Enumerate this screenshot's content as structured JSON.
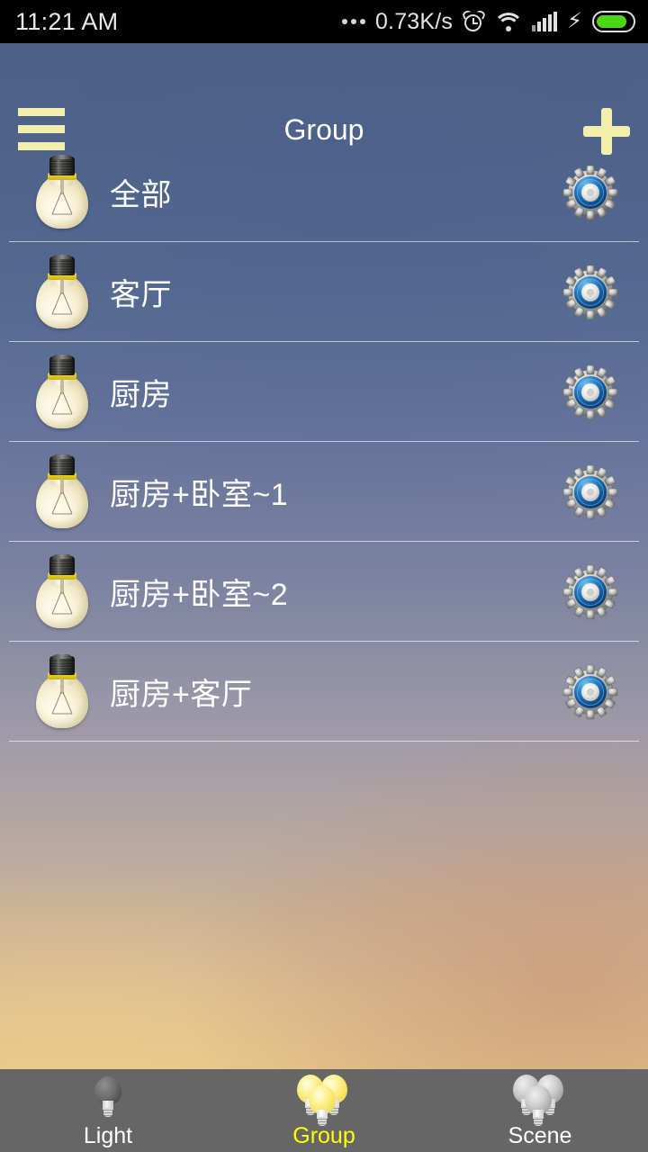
{
  "statusbar": {
    "time": "11:21 AM",
    "network_speed": "0.73K/s",
    "icons": [
      "overflow-dots",
      "alarm-icon",
      "wifi-icon",
      "signal-icon",
      "charging-bolt-icon",
      "battery-icon"
    ],
    "battery_charging": true
  },
  "header": {
    "title": "Group",
    "menu_icon": "hamburger-menu-icon",
    "add_icon": "plus-icon",
    "accent_color": "#f1eeae"
  },
  "groups": [
    {
      "name": "全部",
      "bulb_icon": "light-bulb-icon",
      "settings_icon": "gear-icon"
    },
    {
      "name": "客厅",
      "bulb_icon": "light-bulb-icon",
      "settings_icon": "gear-icon"
    },
    {
      "name": "厨房",
      "bulb_icon": "light-bulb-icon",
      "settings_icon": "gear-icon"
    },
    {
      "name": "厨房+卧室~1",
      "bulb_icon": "light-bulb-icon",
      "settings_icon": "gear-icon"
    },
    {
      "name": "厨房+卧室~2",
      "bulb_icon": "light-bulb-icon",
      "settings_icon": "gear-icon"
    },
    {
      "name": "厨房+客厅",
      "bulb_icon": "light-bulb-icon",
      "settings_icon": "gear-icon"
    }
  ],
  "bottom_nav": {
    "active_color": "#ffff00",
    "inactive_color": "#ffffff",
    "tabs": [
      {
        "label": "Light",
        "icon": "single-bulb-icon",
        "active": false
      },
      {
        "label": "Group",
        "icon": "triple-bulb-icon",
        "active": true
      },
      {
        "label": "Scene",
        "icon": "scene-bulbs-icon",
        "active": false
      }
    ]
  }
}
